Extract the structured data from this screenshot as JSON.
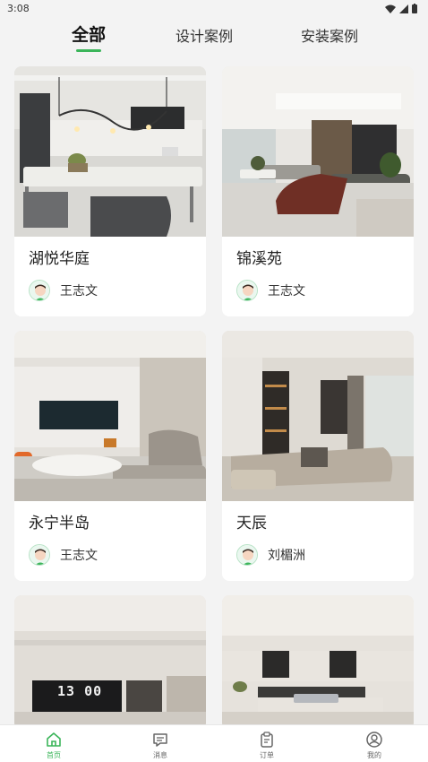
{
  "status_bar": {
    "time": "3:08"
  },
  "tabs": [
    {
      "label": "全部",
      "active": true
    },
    {
      "label": "设计案例",
      "active": false
    },
    {
      "label": "安装案例",
      "active": false
    }
  ],
  "cases": [
    {
      "title": "湖悦华庭",
      "designer": "王志文"
    },
    {
      "title": "锦溪苑",
      "designer": "王志文"
    },
    {
      "title": "永宁半岛",
      "designer": "王志文"
    },
    {
      "title": "天辰",
      "designer": "刘楣洲"
    },
    {
      "title": "",
      "designer": ""
    },
    {
      "title": "",
      "designer": ""
    }
  ],
  "photo_text": {
    "clock_display": "13 00"
  },
  "bottom_nav": [
    {
      "label": "首页",
      "icon": "home-icon",
      "active": true
    },
    {
      "label": "消息",
      "icon": "message-icon",
      "active": false
    },
    {
      "label": "订单",
      "icon": "order-icon",
      "active": false
    },
    {
      "label": "我的",
      "icon": "profile-icon",
      "active": false
    }
  ],
  "colors": {
    "accent": "#3bb55a",
    "background": "#f3f3f3",
    "card": "#ffffff"
  }
}
